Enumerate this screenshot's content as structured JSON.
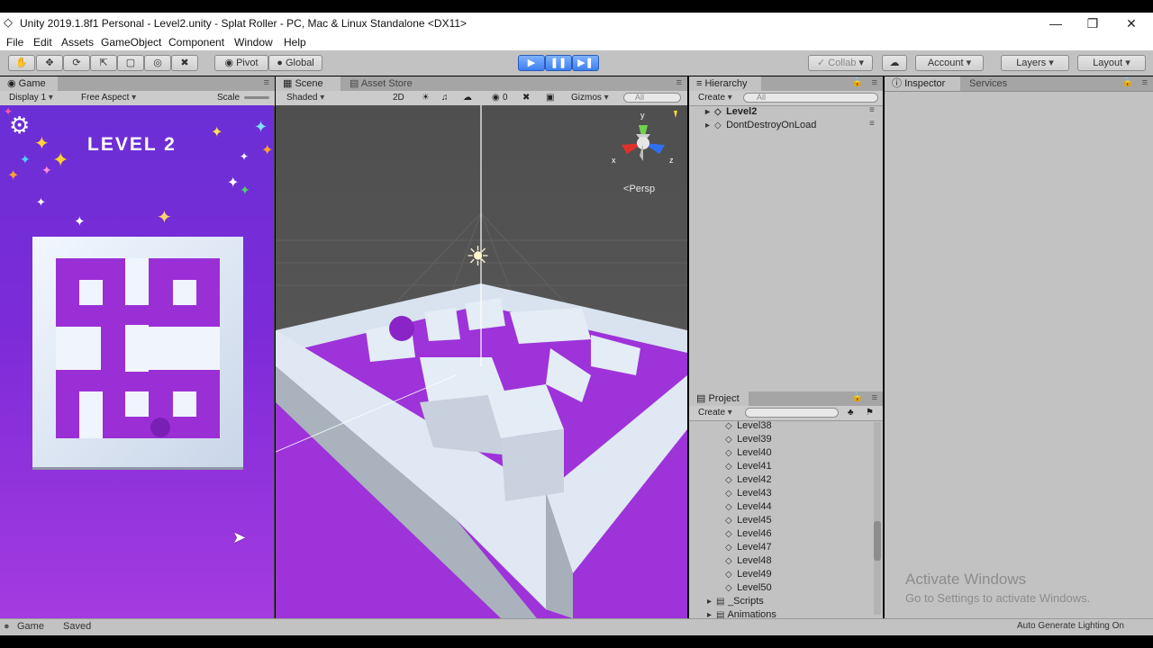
{
  "window": {
    "title": "Unity 2019.1.8f1 Personal - Level2.unity - Splat Roller - PC, Mac & Linux Standalone <DX11>",
    "controls": [
      "minimize",
      "restore",
      "close"
    ]
  },
  "menu": [
    "File",
    "Edit",
    "Assets",
    "GameObject",
    "Component",
    "Window",
    "Help"
  ],
  "toolbar": {
    "pivot": "Pivot",
    "global": "Global",
    "collab": "Collab",
    "account": "Account",
    "layers": "Layers",
    "layout": "Layout"
  },
  "game": {
    "tab": "Game",
    "display": "Display 1",
    "aspect": "Free Aspect",
    "scale": "Scale",
    "level_label": "LEVEL 2"
  },
  "scene": {
    "tab": "Scene",
    "asset_store_tab": "Asset Store",
    "shading": "Shaded",
    "mode_2d": "2D",
    "fx_count": "0",
    "gizmos": "Gizmos",
    "search_placeholder": "All",
    "persp": "Persp",
    "axes": {
      "x": "x",
      "y": "y",
      "z": "z"
    }
  },
  "hierarchy": {
    "tab": "Hierarchy",
    "create": "Create",
    "search_placeholder": "All",
    "items": [
      "Level2",
      "DontDestroyOnLoad"
    ]
  },
  "project": {
    "tab": "Project",
    "create": "Create",
    "items": [
      "Level38",
      "Level39",
      "Level40",
      "Level41",
      "Level42",
      "Level43",
      "Level44",
      "Level45",
      "Level46",
      "Level47",
      "Level48",
      "Level49",
      "Level50"
    ],
    "folders": [
      "_Scripts",
      "Animations"
    ]
  },
  "inspector": {
    "tab": "Inspector",
    "services_tab": "Services"
  },
  "watermark": {
    "line1": "Activate Windows",
    "line2": "Go to Settings to activate Windows."
  },
  "status": {
    "left": "Game",
    "left2": "Saved",
    "right": "Auto Generate Lighting On"
  },
  "colors": {
    "editor_bg": "#c2c2c2",
    "play_blue": "#3d7ff0",
    "game_purple": "#7d2bd8",
    "maze_purple": "#9b2fd6"
  }
}
